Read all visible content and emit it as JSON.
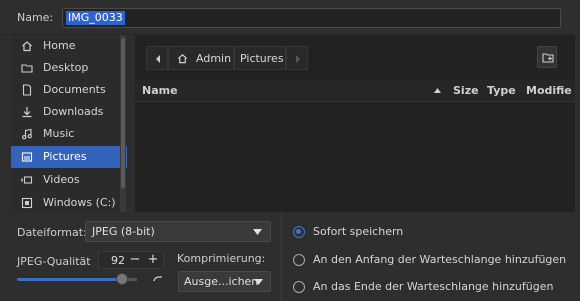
{
  "name": {
    "label": "Name:",
    "value": "IMG_0033"
  },
  "sidebar": {
    "items": [
      {
        "label": "Home",
        "icon": "home-icon"
      },
      {
        "label": "Desktop",
        "icon": "folder-icon"
      },
      {
        "label": "Documents",
        "icon": "document-icon"
      },
      {
        "label": "Downloads",
        "icon": "download-icon"
      },
      {
        "label": "Music",
        "icon": "music-icon"
      },
      {
        "label": "Pictures",
        "icon": "picture-icon",
        "selected": true
      },
      {
        "label": "Videos",
        "icon": "video-icon"
      },
      {
        "label": "Windows (C:)",
        "icon": "drive-icon"
      }
    ]
  },
  "path": {
    "crumbs": [
      "Admin",
      "Pictures"
    ]
  },
  "table": {
    "columns": [
      "Name",
      "Size",
      "Type",
      "Modifie"
    ]
  },
  "format": {
    "label": "Dateiformat:",
    "value": "JPEG (8-bit)"
  },
  "quality": {
    "label": "JPEG-Qualität",
    "value": "92",
    "minus": "−",
    "plus": "+"
  },
  "compression": {
    "label": "Komprimierung:",
    "value": "Ausge...ichen"
  },
  "radios": [
    {
      "label": "Sofort speichern",
      "checked": true
    },
    {
      "label": "An den Anfang der Warteschlange hinzufügen",
      "checked": false
    },
    {
      "label": "An das Ende der Warteschlange hinzufügen",
      "checked": false
    }
  ],
  "colors": {
    "accent": "#3463bb",
    "background": "#2e2e2e"
  }
}
